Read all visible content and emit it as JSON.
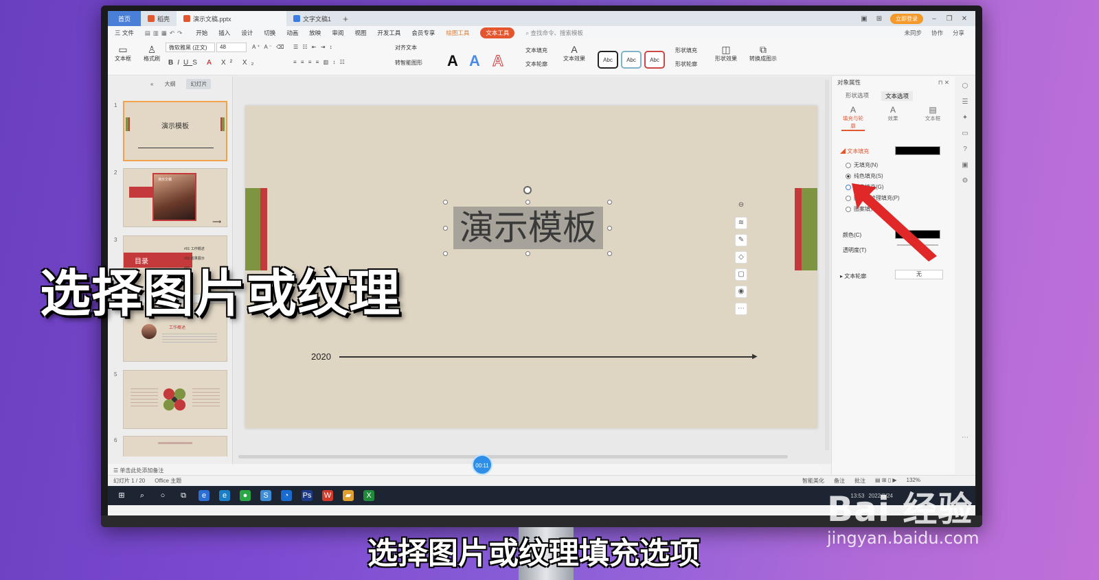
{
  "titlebar": {
    "tabs": [
      {
        "label": "首页"
      },
      {
        "label": "稻壳"
      },
      {
        "label": "演示文稿.pptx"
      },
      {
        "label": "文字文稿1"
      }
    ],
    "new_tab": "+",
    "login": "立即登录"
  },
  "menubar": {
    "items": [
      "三 文件",
      "开始",
      "插入",
      "设计",
      "切换",
      "动画",
      "放映",
      "审阅",
      "视图",
      "开发工具",
      "会员专享"
    ],
    "context_tab": "绘图工具",
    "active_tab": "文本工具",
    "search": "查找命令、搜索模板",
    "right": [
      "未同步",
      "协作",
      "分享"
    ]
  },
  "ribbon": {
    "textbox": "文本框",
    "format_painter": "格式刷",
    "font_name": "微软雅黑 (正文)",
    "font_size": "48",
    "align_text": "对齐文本",
    "smart_shape": "转智能图形",
    "text_fill": "文本填充",
    "text_outline": "文本轮廓",
    "text_effect": "文本效果",
    "abc": "Abc",
    "shape_fill": "形状填充",
    "shape_outline": "形状轮廓",
    "shape_effect": "形状效果",
    "to_image": "转换成图示"
  },
  "leftpanel": {
    "tab_outline": "大纲",
    "tab_slides": "幻灯片",
    "thumbs": [
      {
        "num": "1",
        "title": "演示模板"
      },
      {
        "num": "2",
        "title": "演示文稿"
      },
      {
        "num": "3",
        "title": "目录",
        "items": [
          "#01 工作概述",
          "#02 成果展示",
          "#03",
          "#04"
        ]
      },
      {
        "num": "4",
        "title": "工作概述"
      },
      {
        "num": "5"
      },
      {
        "num": "6"
      }
    ],
    "add": "+"
  },
  "slide": {
    "title": "演示模板",
    "year": "2020"
  },
  "canvas": {
    "notes": "单击此处添加备注",
    "timer": "00:11"
  },
  "rightpanel": {
    "header": "对象属性",
    "tabs": [
      "形状选项",
      "文本选项"
    ],
    "subtabs": [
      "填充与轮廓",
      "效果",
      "文本框"
    ],
    "text_fill": "文本填充",
    "options": [
      "无填充(N)",
      "纯色填充(S)",
      "渐变填充(G)",
      "图片或纹理填充(P)",
      "图案填充(A)"
    ],
    "color": "颜色(C)",
    "transparency": "透明度(T)",
    "text_outline": "文本轮廓",
    "outline_value": "无"
  },
  "statusbar": {
    "slide_info": "幻灯片 1 / 20",
    "theme": "Office 主题",
    "beautify": "智能美化",
    "notes": "备注",
    "comments": "批注",
    "zoom": "132%"
  },
  "taskbar": {
    "time": "13:53",
    "date": "2022/8/24"
  },
  "overlay": {
    "title": "选择图片或纹理",
    "subtitle": "选择图片或纹理填充选项"
  },
  "watermark": {
    "brand": "Bai 经验",
    "url": "jingyan.baidu.com"
  },
  "colors": {
    "accent": "#e4572e",
    "slide_bg": "#dfd5c3",
    "bar_green": "#7f9440",
    "bar_red": "#c43a3a"
  }
}
